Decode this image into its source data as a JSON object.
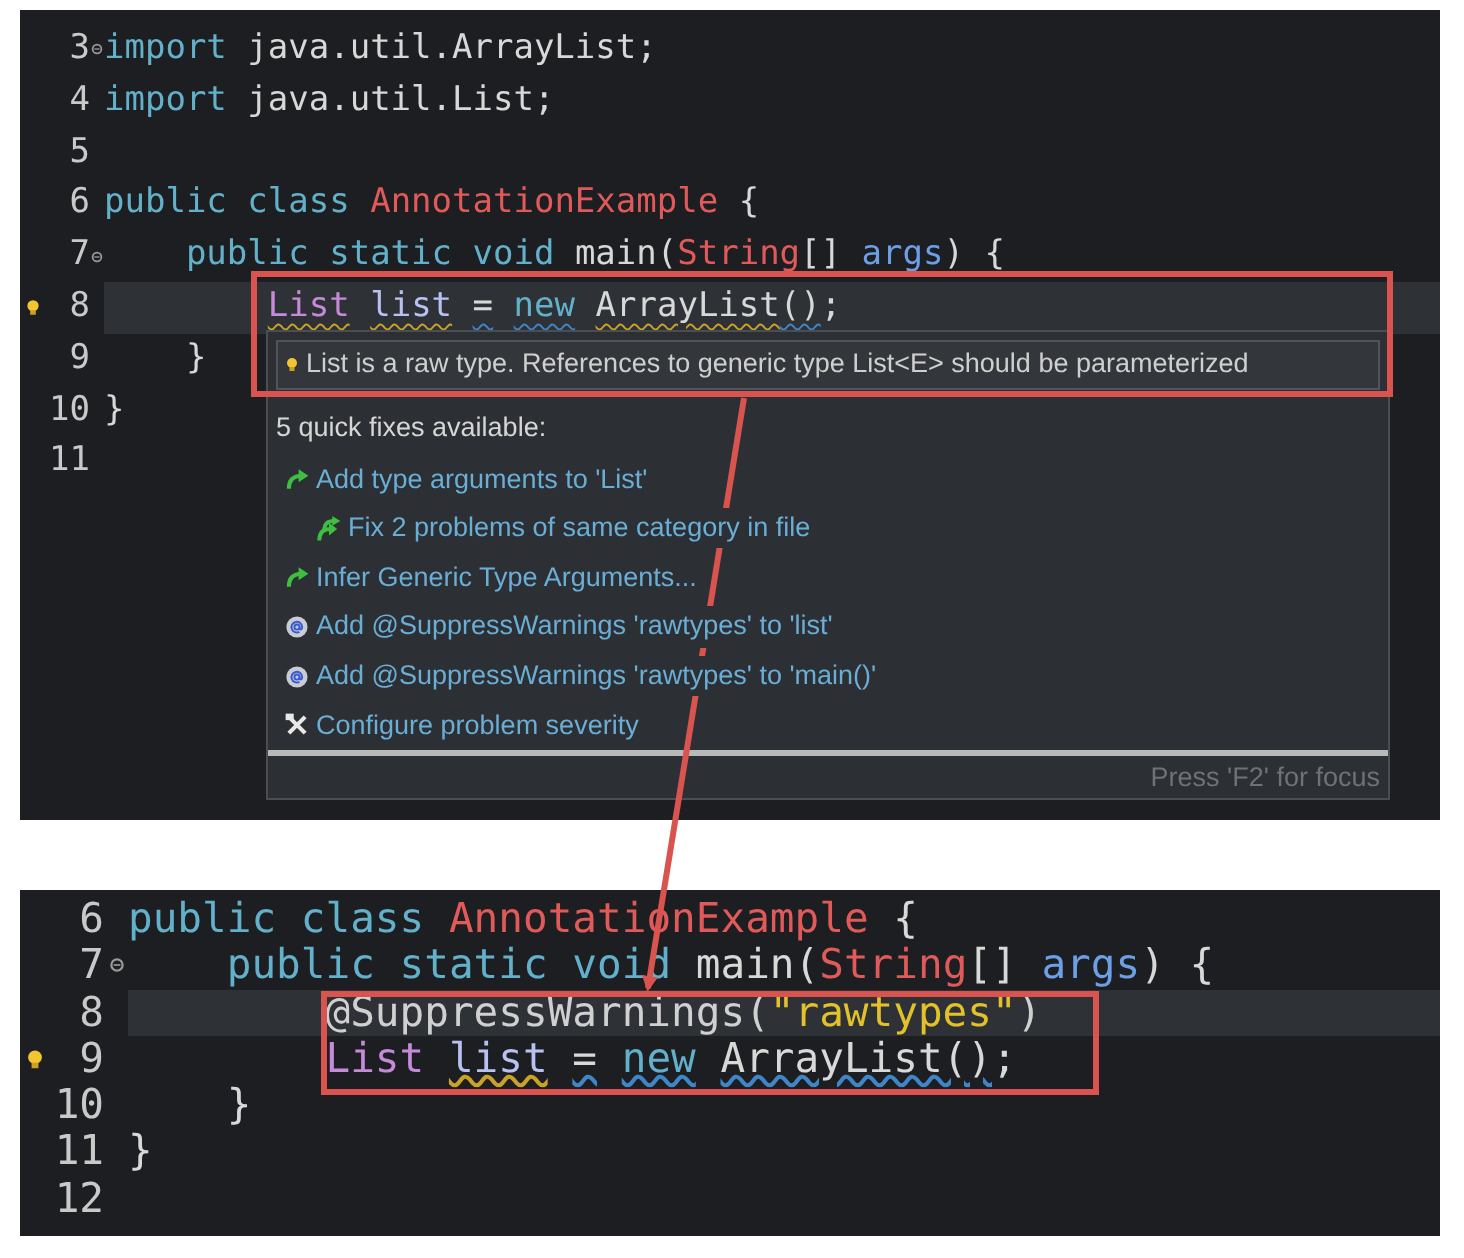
{
  "top_editor": {
    "lines": [
      {
        "number": "3",
        "fold_marker": true,
        "lightbulb": false,
        "current": false,
        "tokens": [
          {
            "text": "import",
            "kind": "keyword"
          },
          {
            "text": " java.util.ArrayList;",
            "kind": "plain"
          }
        ]
      },
      {
        "number": "4",
        "fold_marker": false,
        "lightbulb": false,
        "current": false,
        "tokens": [
          {
            "text": "import",
            "kind": "keyword"
          },
          {
            "text": " java.util.List;",
            "kind": "plain"
          }
        ]
      },
      {
        "number": "5",
        "fold_marker": false,
        "lightbulb": false,
        "current": false
      },
      {
        "number": "6",
        "fold_marker": false,
        "lightbulb": false,
        "current": false,
        "tokens": [
          {
            "text": "public",
            "kind": "keyword"
          },
          {
            "text": " class",
            "kind": "keyword"
          },
          {
            "text": " AnnotationExample",
            "kind": "class"
          },
          {
            "text": " {",
            "kind": "plain"
          }
        ]
      },
      {
        "number": "7",
        "fold_marker": true,
        "lightbulb": false,
        "current": false,
        "tokens": [
          {
            "text": "    public",
            "kind": "keyword"
          },
          {
            "text": " static",
            "kind": "keyword"
          },
          {
            "text": " void",
            "kind": "keyword"
          },
          {
            "text": " main(",
            "kind": "plain"
          },
          {
            "text": "String",
            "kind": "class"
          },
          {
            "text": "[]",
            "kind": "plain"
          },
          {
            "text": " args",
            "kind": "param"
          },
          {
            "text": ") {",
            "kind": "plain"
          }
        ]
      },
      {
        "number": "8",
        "fold_marker": false,
        "lightbulb": true,
        "current": true,
        "tokens": [
          {
            "text": "        List",
            "kind": "type",
            "color": "#c9a227"
          },
          {
            "text": " list",
            "kind": "variable",
            "color": "#c9a227"
          },
          {
            "text": " =",
            "kind": "plain",
            "color": "#3f86c9"
          },
          {
            "text": " new",
            "kind": "keyword",
            "color": "#3f86c9"
          },
          {
            "text": " ArrayList",
            "kind": "plain",
            "color": "#c9a227"
          },
          {
            "text": "()",
            "kind": "plain",
            "color": "#3f86c9"
          },
          {
            "text": ";",
            "kind": "plain"
          }
        ]
      },
      {
        "number": "9",
        "fold_marker": false,
        "lightbulb": false,
        "current": false,
        "tokens": [
          {
            "text": "    }",
            "kind": "plain"
          }
        ]
      },
      {
        "number": "10",
        "fold_marker": false,
        "lightbulb": false,
        "current": false,
        "tokens": [
          {
            "text": "}",
            "kind": "plain"
          }
        ]
      },
      {
        "number": "11",
        "fold_marker": false,
        "lightbulb": false,
        "current": false
      }
    ]
  },
  "quick_fix_popup": {
    "message": "List is a raw type. References to generic type List<E> should be parameterized",
    "heading": "5 quick fixes available:",
    "fixes": [
      {
        "label": "Add type arguments to 'List'",
        "kind": "change",
        "children": [
          {
            "label": "Fix 2 problems of same category in file",
            "kind": "multi"
          }
        ]
      },
      {
        "label": "Infer Generic Type Arguments...",
        "kind": "change"
      },
      {
        "label": "Add @SuppressWarnings 'rawtypes' to 'list'",
        "kind": "annotation"
      },
      {
        "label": "Add @SuppressWarnings 'rawtypes' to 'main()'",
        "kind": "annotation"
      },
      {
        "label": "Configure problem severity",
        "kind": "config"
      }
    ],
    "footer": "Press 'F2' for focus"
  },
  "bottom_editor": {
    "lines": [
      {
        "number": "6",
        "fold_marker": false,
        "lightbulb": false,
        "current": false,
        "tokens": [
          {
            "text": "public",
            "kind": "keyword"
          },
          {
            "text": " class",
            "kind": "keyword"
          },
          {
            "text": " AnnotationExample",
            "kind": "class"
          },
          {
            "text": " {",
            "kind": "plain"
          }
        ]
      },
      {
        "number": "7",
        "fold_marker": true,
        "lightbulb": false,
        "current": false,
        "tokens": [
          {
            "text": "    public",
            "kind": "keyword"
          },
          {
            "text": " static",
            "kind": "keyword"
          },
          {
            "text": " void",
            "kind": "keyword"
          },
          {
            "text": " main(",
            "kind": "plain"
          },
          {
            "text": "String",
            "kind": "class"
          },
          {
            "text": "[]",
            "kind": "plain"
          },
          {
            "text": " args",
            "kind": "param"
          },
          {
            "text": ") {",
            "kind": "plain"
          }
        ]
      },
      {
        "number": "8",
        "fold_marker": false,
        "lightbulb": false,
        "current": true,
        "tokens": [
          {
            "text": "        @SuppressWarnings(",
            "kind": "annotation"
          },
          {
            "text": "\"rawtypes\"",
            "kind": "string"
          },
          {
            "text": ")",
            "kind": "annotation"
          }
        ]
      },
      {
        "number": "9",
        "fold_marker": false,
        "lightbulb": true,
        "current": false,
        "tokens": [
          {
            "text": "        List",
            "kind": "type"
          },
          {
            "text": " list",
            "kind": "variable",
            "color": "#c9a227"
          },
          {
            "text": " =",
            "kind": "plain",
            "color": "#3f86c9"
          },
          {
            "text": " new",
            "kind": "keyword",
            "color": "#3f86c9"
          },
          {
            "text": " ArrayList()",
            "kind": "plain",
            "color": "#3f86c9"
          },
          {
            "text": ";",
            "kind": "plain"
          }
        ]
      },
      {
        "number": "10",
        "fold_marker": false,
        "lightbulb": false,
        "current": false,
        "tokens": [
          {
            "text": "    }",
            "kind": "plain"
          }
        ]
      },
      {
        "number": "11",
        "fold_marker": false,
        "lightbulb": false,
        "current": false,
        "tokens": [
          {
            "text": "}",
            "kind": "plain"
          }
        ]
      },
      {
        "number": "12",
        "fold_marker": false,
        "lightbulb": false,
        "current": false
      }
    ]
  }
}
